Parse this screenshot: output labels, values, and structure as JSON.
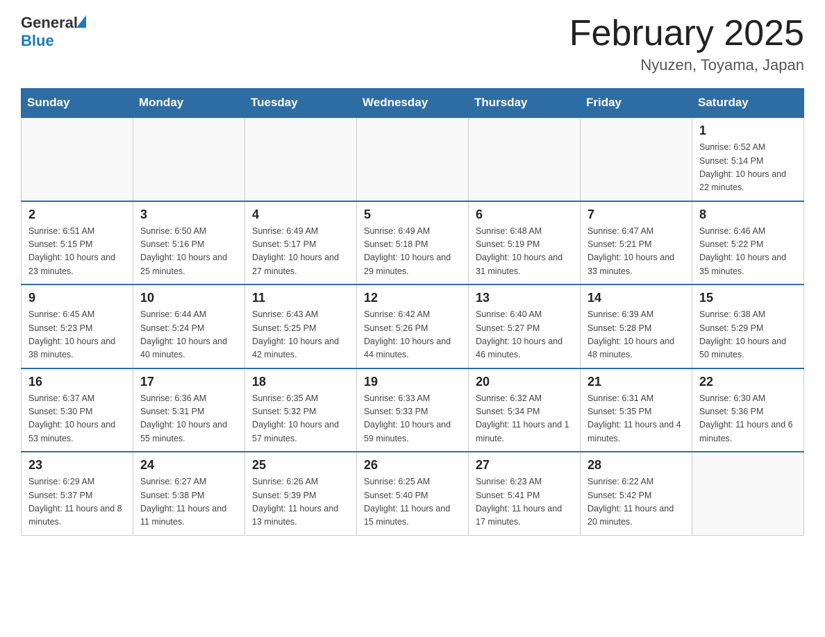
{
  "header": {
    "logo_general": "General",
    "logo_blue": "Blue",
    "title": "February 2025",
    "subtitle": "Nyuzen, Toyama, Japan"
  },
  "days_of_week": [
    "Sunday",
    "Monday",
    "Tuesday",
    "Wednesday",
    "Thursday",
    "Friday",
    "Saturday"
  ],
  "weeks": [
    [
      {
        "day": "",
        "info": ""
      },
      {
        "day": "",
        "info": ""
      },
      {
        "day": "",
        "info": ""
      },
      {
        "day": "",
        "info": ""
      },
      {
        "day": "",
        "info": ""
      },
      {
        "day": "",
        "info": ""
      },
      {
        "day": "1",
        "info": "Sunrise: 6:52 AM\nSunset: 5:14 PM\nDaylight: 10 hours and 22 minutes."
      }
    ],
    [
      {
        "day": "2",
        "info": "Sunrise: 6:51 AM\nSunset: 5:15 PM\nDaylight: 10 hours and 23 minutes."
      },
      {
        "day": "3",
        "info": "Sunrise: 6:50 AM\nSunset: 5:16 PM\nDaylight: 10 hours and 25 minutes."
      },
      {
        "day": "4",
        "info": "Sunrise: 6:49 AM\nSunset: 5:17 PM\nDaylight: 10 hours and 27 minutes."
      },
      {
        "day": "5",
        "info": "Sunrise: 6:49 AM\nSunset: 5:18 PM\nDaylight: 10 hours and 29 minutes."
      },
      {
        "day": "6",
        "info": "Sunrise: 6:48 AM\nSunset: 5:19 PM\nDaylight: 10 hours and 31 minutes."
      },
      {
        "day": "7",
        "info": "Sunrise: 6:47 AM\nSunset: 5:21 PM\nDaylight: 10 hours and 33 minutes."
      },
      {
        "day": "8",
        "info": "Sunrise: 6:46 AM\nSunset: 5:22 PM\nDaylight: 10 hours and 35 minutes."
      }
    ],
    [
      {
        "day": "9",
        "info": "Sunrise: 6:45 AM\nSunset: 5:23 PM\nDaylight: 10 hours and 38 minutes."
      },
      {
        "day": "10",
        "info": "Sunrise: 6:44 AM\nSunset: 5:24 PM\nDaylight: 10 hours and 40 minutes."
      },
      {
        "day": "11",
        "info": "Sunrise: 6:43 AM\nSunset: 5:25 PM\nDaylight: 10 hours and 42 minutes."
      },
      {
        "day": "12",
        "info": "Sunrise: 6:42 AM\nSunset: 5:26 PM\nDaylight: 10 hours and 44 minutes."
      },
      {
        "day": "13",
        "info": "Sunrise: 6:40 AM\nSunset: 5:27 PM\nDaylight: 10 hours and 46 minutes."
      },
      {
        "day": "14",
        "info": "Sunrise: 6:39 AM\nSunset: 5:28 PM\nDaylight: 10 hours and 48 minutes."
      },
      {
        "day": "15",
        "info": "Sunrise: 6:38 AM\nSunset: 5:29 PM\nDaylight: 10 hours and 50 minutes."
      }
    ],
    [
      {
        "day": "16",
        "info": "Sunrise: 6:37 AM\nSunset: 5:30 PM\nDaylight: 10 hours and 53 minutes."
      },
      {
        "day": "17",
        "info": "Sunrise: 6:36 AM\nSunset: 5:31 PM\nDaylight: 10 hours and 55 minutes."
      },
      {
        "day": "18",
        "info": "Sunrise: 6:35 AM\nSunset: 5:32 PM\nDaylight: 10 hours and 57 minutes."
      },
      {
        "day": "19",
        "info": "Sunrise: 6:33 AM\nSunset: 5:33 PM\nDaylight: 10 hours and 59 minutes."
      },
      {
        "day": "20",
        "info": "Sunrise: 6:32 AM\nSunset: 5:34 PM\nDaylight: 11 hours and 1 minute."
      },
      {
        "day": "21",
        "info": "Sunrise: 6:31 AM\nSunset: 5:35 PM\nDaylight: 11 hours and 4 minutes."
      },
      {
        "day": "22",
        "info": "Sunrise: 6:30 AM\nSunset: 5:36 PM\nDaylight: 11 hours and 6 minutes."
      }
    ],
    [
      {
        "day": "23",
        "info": "Sunrise: 6:29 AM\nSunset: 5:37 PM\nDaylight: 11 hours and 8 minutes."
      },
      {
        "day": "24",
        "info": "Sunrise: 6:27 AM\nSunset: 5:38 PM\nDaylight: 11 hours and 11 minutes."
      },
      {
        "day": "25",
        "info": "Sunrise: 6:26 AM\nSunset: 5:39 PM\nDaylight: 11 hours and 13 minutes."
      },
      {
        "day": "26",
        "info": "Sunrise: 6:25 AM\nSunset: 5:40 PM\nDaylight: 11 hours and 15 minutes."
      },
      {
        "day": "27",
        "info": "Sunrise: 6:23 AM\nSunset: 5:41 PM\nDaylight: 11 hours and 17 minutes."
      },
      {
        "day": "28",
        "info": "Sunrise: 6:22 AM\nSunset: 5:42 PM\nDaylight: 11 hours and 20 minutes."
      },
      {
        "day": "",
        "info": ""
      }
    ]
  ]
}
